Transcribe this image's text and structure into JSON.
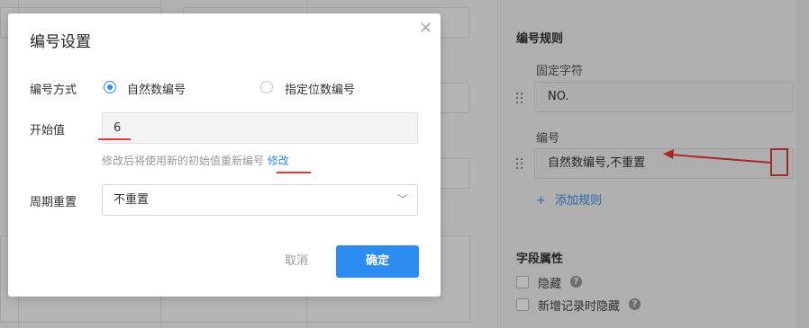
{
  "modal": {
    "title": "编号设置",
    "numbering_mode": {
      "label": "编号方式",
      "options": [
        {
          "label": "自然数编号",
          "selected": true
        },
        {
          "label": "指定位数编号",
          "selected": false
        }
      ]
    },
    "start_value": {
      "label": "开始值",
      "value": "6",
      "hint": "修改后将使用新的初始值重新编号",
      "hint_link": "修改"
    },
    "cycle_reset": {
      "label": "周期重置",
      "value": "不重置"
    },
    "cancel_label": "取消",
    "ok_label": "确定"
  },
  "right_panel": {
    "rules_title": "编号规则",
    "fixed_label": "固定字符",
    "fixed_value": "NO.",
    "number_label": "编号",
    "number_value": "自然数编号,不重置",
    "add_rule": "添加规则",
    "add_icon": "+",
    "field_props_title": "字段属性",
    "hide_label": "隐藏",
    "hide_on_new_label": "新增记录时隐藏"
  },
  "colors": {
    "accent": "#2d8cf0",
    "annotation_red": "#e53935"
  }
}
